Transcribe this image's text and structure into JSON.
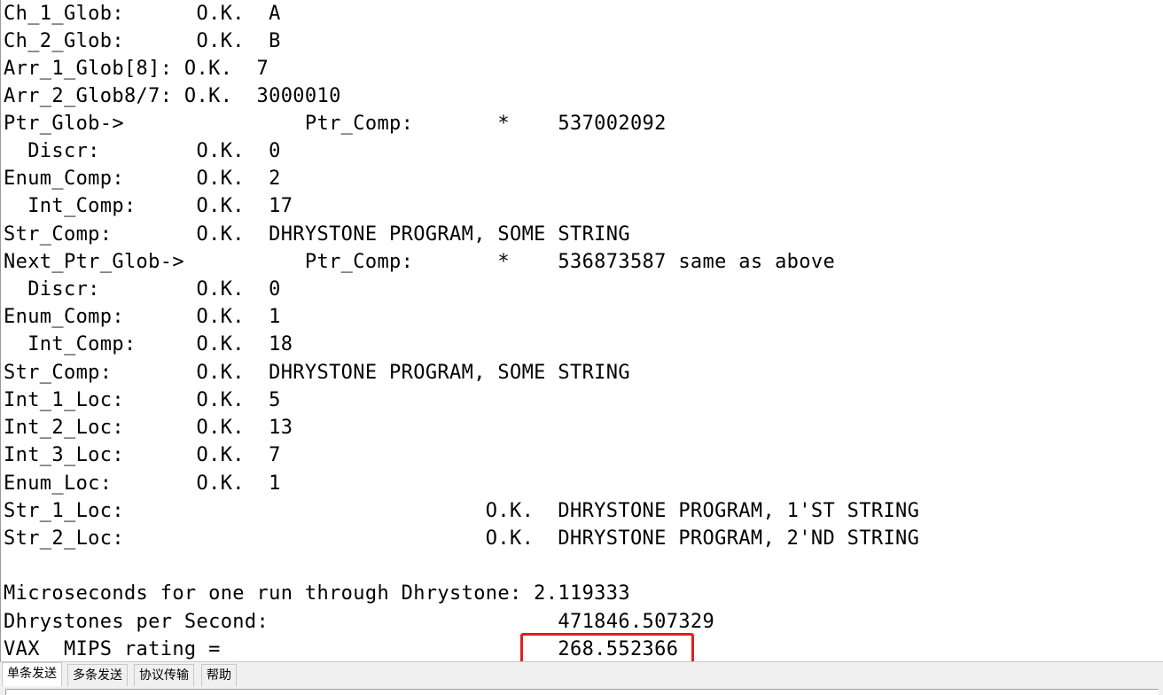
{
  "terminal": {
    "lines": [
      "Ch_1_Glob:      O.K.  A",
      "Ch_2_Glob:      O.K.  B",
      "Arr_1_Glob[8]: O.K.  7",
      "Arr_2_Glob8/7: O.K.  3000010",
      "Ptr_Glob->               Ptr_Comp:       *    537002092",
      "  Discr:        O.K.  0",
      "Enum_Comp:      O.K.  2",
      "  Int_Comp:     O.K.  17",
      "Str_Comp:       O.K.  DHRYSTONE PROGRAM, SOME STRING",
      "Next_Ptr_Glob->          Ptr_Comp:       *    536873587 same as above",
      "  Discr:        O.K.  0",
      "Enum_Comp:      O.K.  1",
      "  Int_Comp:     O.K.  18",
      "Str_Comp:       O.K.  DHRYSTONE PROGRAM, SOME STRING",
      "Int_1_Loc:      O.K.  5",
      "Int_2_Loc:      O.K.  13",
      "Int_3_Loc:      O.K.  7",
      "Enum_Loc:       O.K.  1",
      "Str_1_Loc:                              O.K.  DHRYSTONE PROGRAM, 1'ST STRING",
      "Str_2_Loc:                              O.K.  DHRYSTONE PROGRAM, 2'ND STRING",
      "",
      "Microseconds for one run through Dhrystone: 2.119333",
      "Dhrystones per Second:                        471846.507329",
      "VAX  MIPS rating =                            268.552366"
    ]
  },
  "tabs": [
    {
      "label": "单条发送",
      "active": true
    },
    {
      "label": "多条发送",
      "active": false
    },
    {
      "label": "协议传输",
      "active": false
    },
    {
      "label": "帮助",
      "active": false
    }
  ],
  "highlight_color": "#e0201a"
}
